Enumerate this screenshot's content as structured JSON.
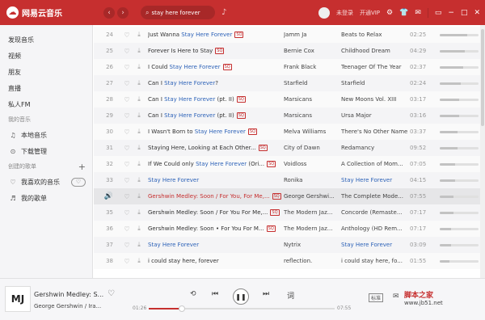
{
  "app": {
    "logo_glyph": "☁",
    "title": "网易云音乐",
    "back": "‹",
    "forward": "›",
    "search_query": "stay here forever",
    "user_label": "未登录",
    "vip_label": "开通VIP",
    "icons": [
      "gear-icon",
      "shirt-icon",
      "mail-icon",
      "miniplayer-icon",
      "minimize-icon",
      "maximize-icon",
      "close-icon"
    ],
    "accent": "#c62f2f"
  },
  "sidebar": {
    "top_items": [
      {
        "label": "发现音乐"
      },
      {
        "label": "视频"
      },
      {
        "label": "朋友"
      },
      {
        "label": "直播"
      },
      {
        "label": "私人FM"
      }
    ],
    "my_music_head": "我的音乐",
    "my_music": [
      {
        "icon": "♫",
        "label": "本地音乐"
      },
      {
        "icon": "⊙",
        "label": "下载管理"
      }
    ],
    "created_head": "创建的歌单",
    "created_plus": "+",
    "created": [
      {
        "icon": "♡",
        "label": "我喜欢的音乐",
        "mode": "♡"
      },
      {
        "icon": "♬",
        "label": "我的歌单"
      }
    ]
  },
  "tracks": [
    {
      "no": "24",
      "title_pre": "Just Wanna ",
      "title_hl": "Stay Here Forever",
      "title_post": "",
      "sq": true,
      "artist": "Jamm Ja",
      "album": "Beats to Relax",
      "dur": "02:25",
      "heat": 0.7
    },
    {
      "no": "25",
      "title_pre": "Forever Is Here to Stay",
      "title_hl": "",
      "title_post": "",
      "sq": true,
      "artist": "Bernie Cox",
      "album": "Childhood Dream",
      "dur": "04:29",
      "heat": 0.65
    },
    {
      "no": "26",
      "title_pre": "I Could ",
      "title_hl": "Stay Here Forever",
      "title_post": "",
      "sq": true,
      "artist": "Frank Black",
      "album": "Teenager Of The Year",
      "dur": "02:37",
      "heat": 0.6
    },
    {
      "no": "27",
      "title_pre": "Can I ",
      "title_hl": "Stay Here Forever",
      "title_post": "?",
      "sq": false,
      "artist": "Starfield",
      "album": "Starfield",
      "dur": "02:24",
      "heat": 0.55
    },
    {
      "no": "28",
      "title_pre": "Can I ",
      "title_hl": "Stay Here Forever",
      "title_post": " (pt. II)",
      "sq": true,
      "artist": "Marsicans",
      "album": "New Moons Vol. XIII",
      "dur": "03:17",
      "heat": 0.5
    },
    {
      "no": "29",
      "title_pre": "Can I ",
      "title_hl": "Stay Here Forever",
      "title_post": " (pt. II)",
      "sq": true,
      "artist": "Marsicans",
      "album": "Ursa Major",
      "dur": "03:16",
      "heat": 0.5
    },
    {
      "no": "30",
      "title_pre": "I Wasn't Born to ",
      "title_hl": "Stay Here Forever",
      "title_post": "",
      "sq": true,
      "artist": "Melva Williams",
      "album": "There's No Other Name",
      "dur": "03:37",
      "heat": 0.45
    },
    {
      "no": "31",
      "title_pre": "Staying Here, Looking at Each Other...",
      "title_hl": "",
      "title_post": "",
      "sq": true,
      "artist": "City of Dawn",
      "album": "Redamancy",
      "dur": "09:52",
      "heat": 0.45
    },
    {
      "no": "32",
      "title_pre": "If We Could only ",
      "title_hl": "Stay Here Forever",
      "title_post": " (Ori...",
      "sq": true,
      "artist": "Voidloss",
      "album": "A Collection of Mom...",
      "dur": "07:05",
      "heat": 0.4
    },
    {
      "no": "33",
      "title_pre": "",
      "title_hl": "Stay Here Forever",
      "title_post": "",
      "sq": false,
      "artist": "Ronika",
      "album": "Stay Here Forever",
      "album_hl": true,
      "dur": "04:15",
      "heat": 0.4
    },
    {
      "no": "34",
      "title_pre": "Gershwin Medley: Soon / For You, For Me,...",
      "title_hl": "",
      "title_post": "",
      "sq": true,
      "playing": true,
      "artist": "George Gershwi...",
      "album": "The Complete Mode...",
      "dur": "07:55",
      "heat": 0.35
    },
    {
      "no": "35",
      "title_pre": "Gershwin Medley: Soon / For You For Me,...",
      "title_hl": "",
      "title_post": "",
      "sq": true,
      "artist": "The Modern Jaz...",
      "album": "Concorde (Remaste...",
      "dur": "07:17",
      "heat": 0.35
    },
    {
      "no": "36",
      "title_pre": "Gershwin Medley: Soon • For You For M...",
      "title_hl": "",
      "title_post": "",
      "sq": true,
      "artist": "The Modern Jaz...",
      "album": "Anthology (HD Rem...",
      "dur": "07:17",
      "heat": 0.3
    },
    {
      "no": "37",
      "title_pre": "",
      "title_hl": "Stay Here Forever",
      "title_post": "",
      "sq": false,
      "artist": "Nytrix",
      "album": "Stay Here Forever",
      "album_hl": true,
      "dur": "03:09",
      "heat": 0.3
    },
    {
      "no": "38",
      "title_pre": "i could stay here, forever",
      "title_hl": "",
      "title_post": "",
      "sq": false,
      "artist": "reflection.",
      "album": "i could stay here, fo...",
      "dur": "01:55",
      "heat": 0.25
    }
  ],
  "sq_label": "SQ",
  "player": {
    "cover_text": "MJ",
    "title": "Gershwin Medley: S...",
    "artist": "George Gershwin / Ira...",
    "current": "01:26",
    "total": "07:55",
    "progress": 0.18,
    "shuffle": "⟲",
    "prev": "⏮",
    "play": "❚❚",
    "next": "⏭",
    "lyric": "词",
    "quality": "标准",
    "share": "✉"
  },
  "watermark": {
    "text": "脚本之家",
    "url": "www.jb51.net"
  }
}
